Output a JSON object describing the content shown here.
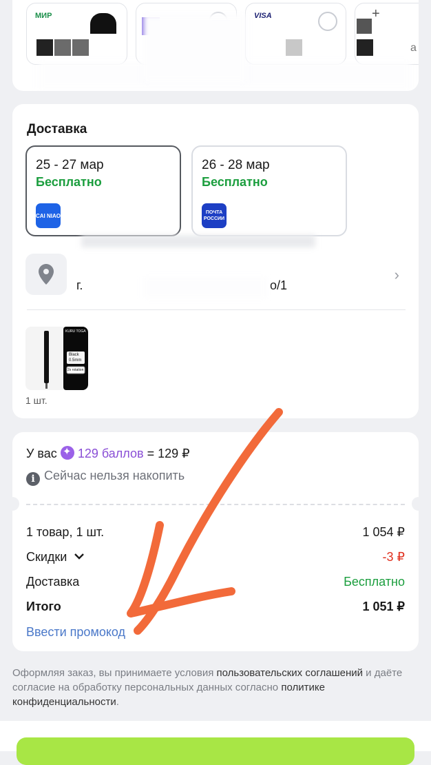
{
  "payment": {
    "cards": [
      {
        "brand": "МИР",
        "color": "#1b8f4a"
      },
      {
        "brand": "",
        "color": "#7a5fe0"
      },
      {
        "brand": "VISA",
        "color": "#1a1f71"
      },
      {
        "brand": "",
        "color": "#555555"
      }
    ],
    "partial_text": "а"
  },
  "delivery": {
    "title": "Доставка",
    "options": [
      {
        "date": "25 - 27 мар",
        "price": "Бесплатно",
        "logo": "CAI NIAO",
        "logo_color": "#1e63e6"
      },
      {
        "date": "26 - 28 мар",
        "price": "Бесплатно",
        "logo": "ПОЧТА РОССИИ",
        "logo_color": "#1d3fc4"
      }
    ],
    "address_prefix": "г.",
    "address_suffix": "о/1",
    "product": {
      "qty": "1 шт.",
      "label_brand": "KURU TOGA",
      "label_color": "Black",
      "label_size": "0.5mm",
      "label_feature": "2x rotation"
    }
  },
  "summary": {
    "points_prefix": "У вас",
    "points_value": "129 баллов",
    "points_equals": "= 129 ₽",
    "cant_accumulate": "Сейчас нельзя накопить",
    "rows": [
      {
        "label": "1 товар, 1 шт.",
        "value": "1 054 ₽"
      },
      {
        "label": "Скидки",
        "value": "-3 ₽"
      },
      {
        "label": "Доставка",
        "value": "Бесплатно"
      },
      {
        "label": "Итого",
        "value": "1 051 ₽"
      }
    ],
    "promo": "Ввести промокод"
  },
  "legal": {
    "t1": "Оформляя заказ, вы принимаете условия ",
    "l1": "пользовательских соглашений",
    "t2": " и даёте согласие на обработку персональных данных согласно ",
    "l2": "политике конфиденциальности",
    "t3": "."
  },
  "colors": {
    "accent_green": "#1b9e3e",
    "discount_red": "#e0301e",
    "link_blue": "#4a78c9",
    "points_purple": "#8a4fd6",
    "cta_green": "#a8e645",
    "annotation_orange": "#f26a3a"
  }
}
